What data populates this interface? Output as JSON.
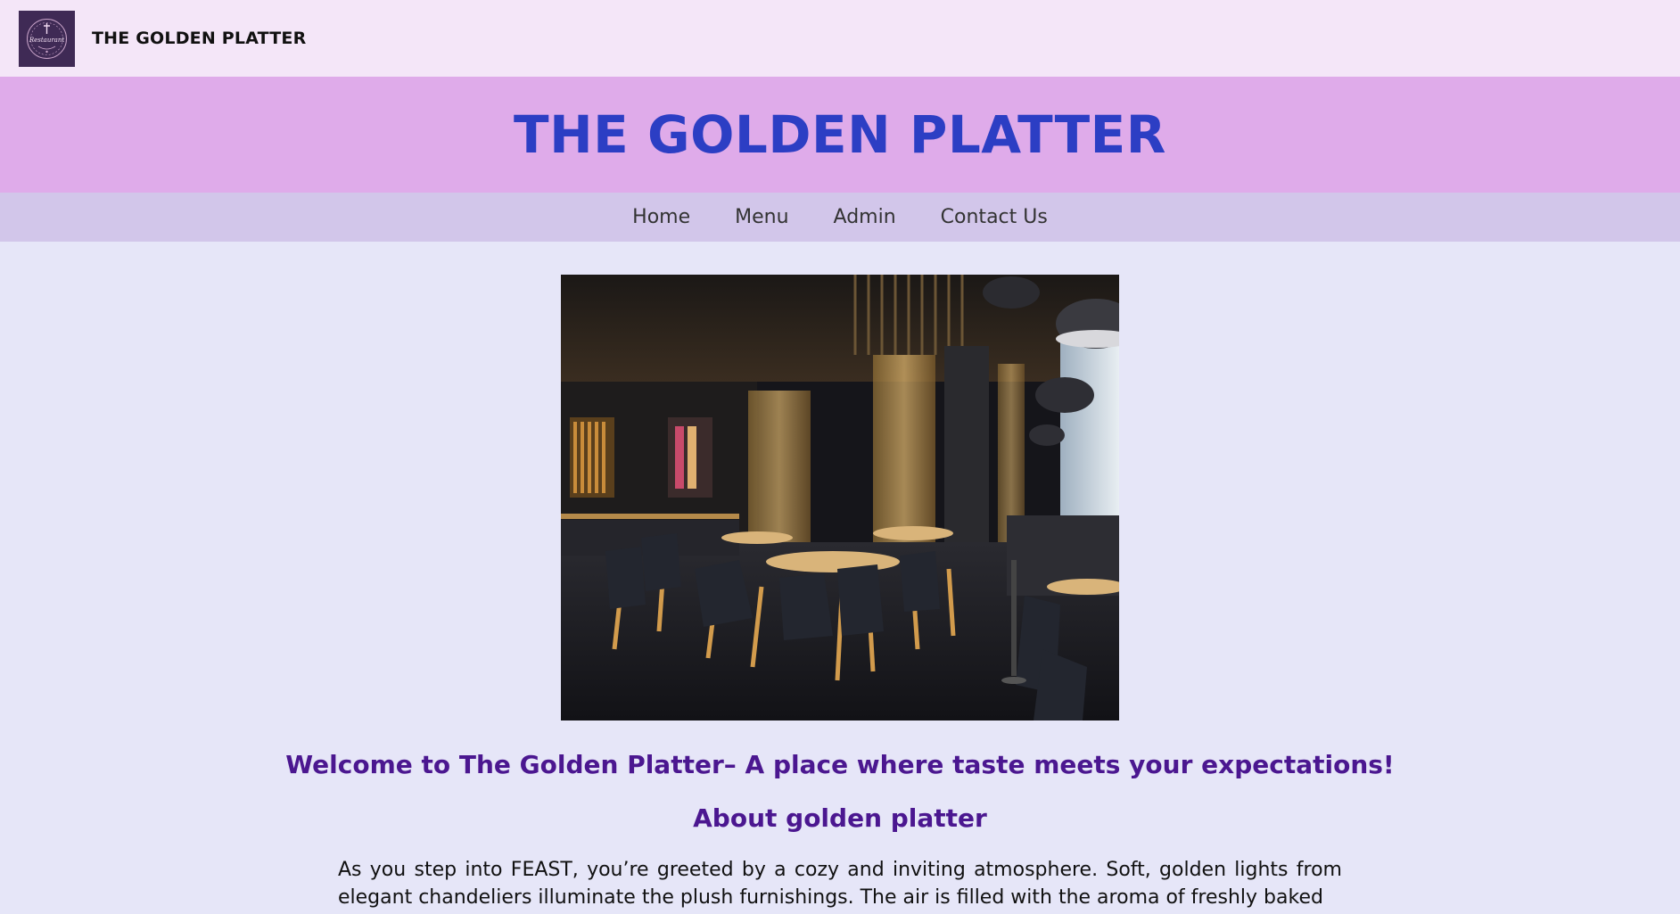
{
  "topbar": {
    "brand": "THE GOLDEN PLATTER",
    "logo_icon": "restaurant-logo-icon"
  },
  "hero": {
    "title": "THE GOLDEN PLATTER"
  },
  "nav": {
    "items": [
      {
        "label": "Home"
      },
      {
        "label": "Menu"
      },
      {
        "label": "Admin"
      },
      {
        "label": "Contact Us"
      }
    ]
  },
  "main": {
    "welcome": "Welcome to The Golden Platter– A place where taste meets your expectations!",
    "about_heading": "About golden platter",
    "about_text": "As you step into FEAST, you’re greeted by a cozy and inviting atmosphere. Soft, golden lights from elegant chandeliers illuminate the plush furnishings. The air is filled with the aroma of freshly baked"
  },
  "colors": {
    "topbar_bg": "#f4e6f8",
    "hero_bg": "#dfabea",
    "hero_title": "#2c3ec4",
    "nav_bg": "#d2c6ea",
    "page_bg": "#e6e6f8",
    "heading": "#4b1790"
  }
}
